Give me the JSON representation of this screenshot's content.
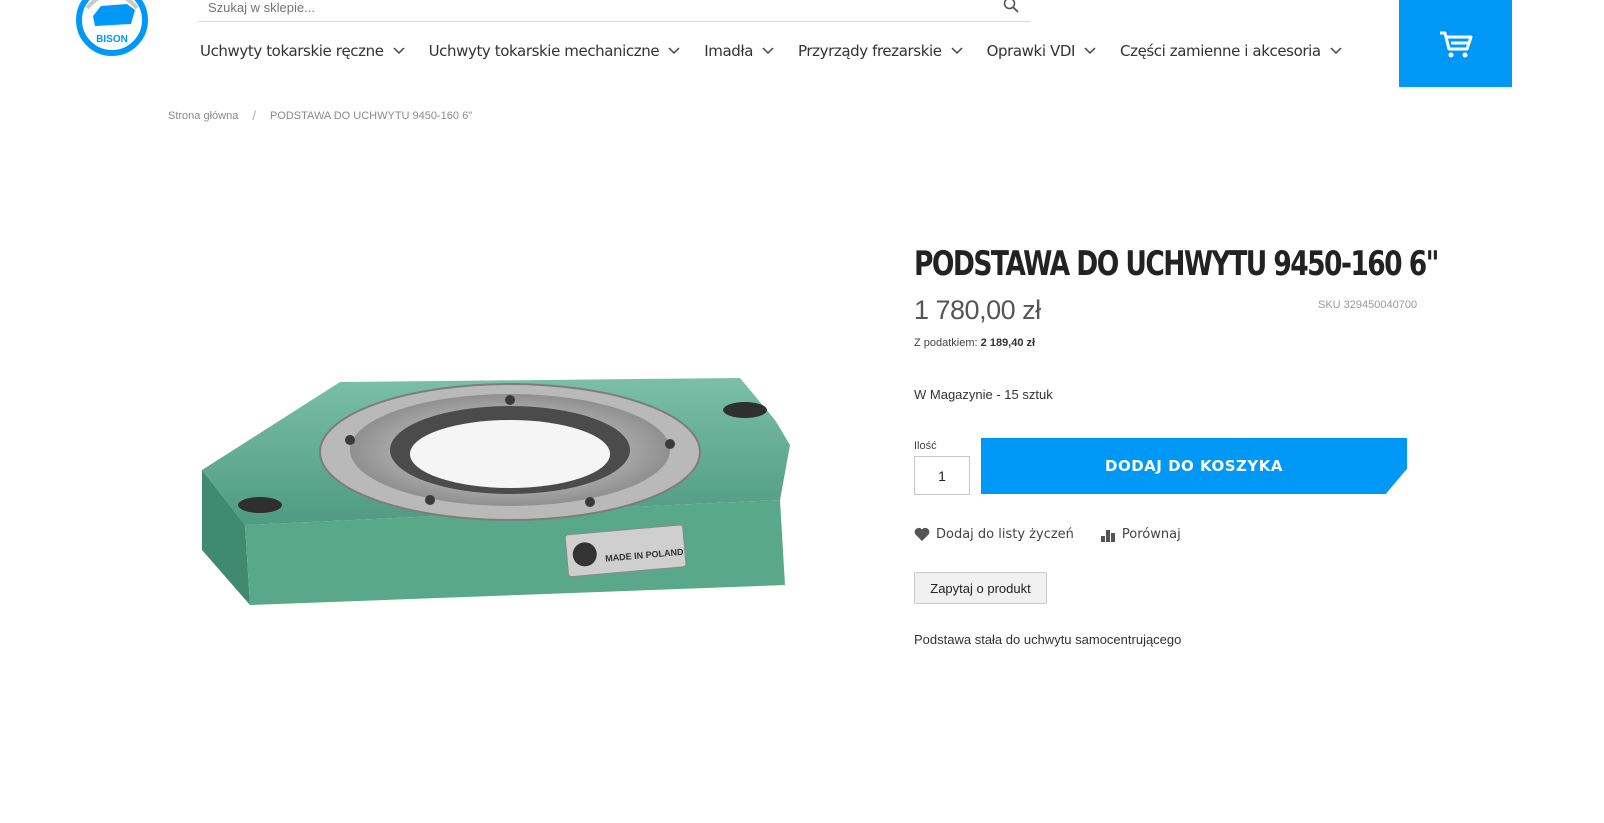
{
  "brand": {
    "logo_text": "BISON",
    "accent": "#0098f7"
  },
  "search": {
    "placeholder": "Szukaj w sklepie..."
  },
  "nav": [
    {
      "label": "Uchwyty tokarskie ręczne"
    },
    {
      "label": "Uchwyty tokarskie mechaniczne"
    },
    {
      "label": "Imadła"
    },
    {
      "label": "Przyrządy frezarskie"
    },
    {
      "label": "Oprawki VDI"
    },
    {
      "label": "Części zamienne i akcesoria"
    }
  ],
  "breadcrumb": {
    "home": "Strona główna",
    "separator": "/",
    "current": "PODSTAWA DO UCHWYTU 9450-160 6\""
  },
  "product": {
    "title": "PODSTAWA DO UCHWYTU 9450-160 6\"",
    "price": "1 780,00 zł",
    "sku": "SKU 329450040700",
    "tax_label": "Z podatkiem:",
    "tax_value": "2 189,40 zł",
    "stock": "W Magazynie - 15 sztuk",
    "qty_label": "Ilość",
    "qty_value": "1",
    "add_to_cart": "DODAJ DO KOSZYKA",
    "wishlist": "Dodaj do listy życzeń",
    "compare": "Porównaj",
    "ask": "Zapytaj o produkt",
    "description": "Podstawa stała do uchwytu samocentrującego",
    "image_plate_text": "MADE IN POLAND"
  },
  "icons": {
    "search": "search-icon",
    "cart": "cart-icon",
    "chevron": "chevron-down-icon",
    "heart": "heart-icon",
    "compare": "bar-chart-icon"
  }
}
